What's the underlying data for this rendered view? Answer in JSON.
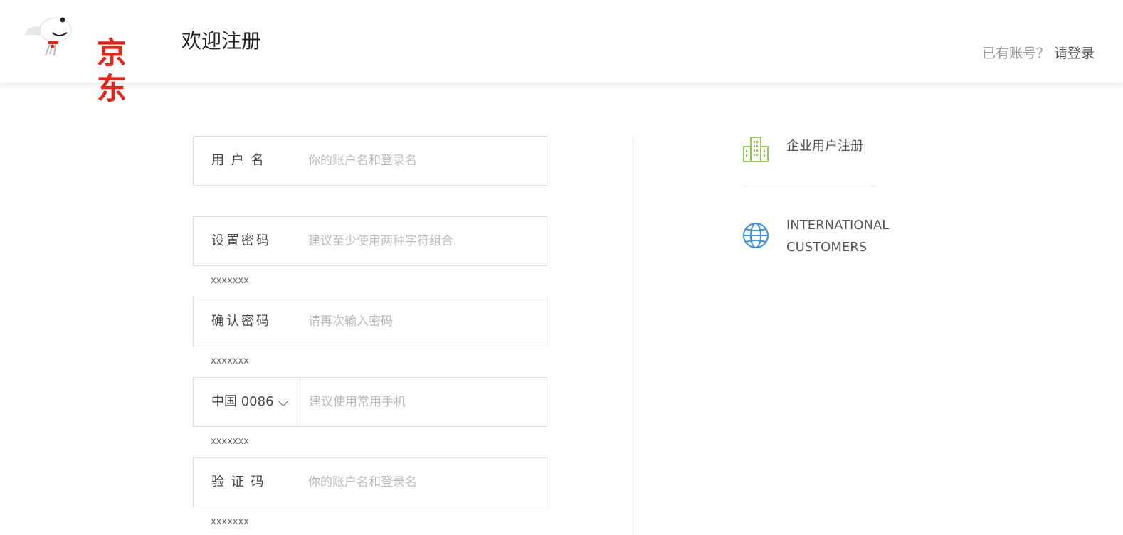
{
  "header": {
    "logo_text": "京东",
    "title": "欢迎注册",
    "have_account": "已有账号？",
    "login_link": "请登录"
  },
  "form": {
    "username": {
      "label": "用 户 名",
      "placeholder": "你的账户名和登录名"
    },
    "password": {
      "label": "设置密码",
      "placeholder": "建议至少使用两种字符组合",
      "hint": "xxxxxxx"
    },
    "confirm": {
      "label": "确认密码",
      "placeholder": "请再次输入密码",
      "hint": "xxxxxxx"
    },
    "phone": {
      "country": "中国 0086",
      "placeholder": "建议使用常用手机",
      "hint": "xxxxxxx"
    },
    "captcha": {
      "label": "验 证 码",
      "placeholder": "你的账户名和登录名",
      "hint": "xxxxxxx"
    }
  },
  "side": {
    "enterprise": {
      "label": "企业用户注册",
      "icon": "building-icon",
      "color": "#8cc152"
    },
    "international": {
      "line1": "INTERNATIONAL",
      "line2": "CUSTOMERS",
      "icon": "globe-icon",
      "color": "#3e8fd8"
    }
  },
  "colors": {
    "brand": "#e1251b",
    "border": "#dddddd",
    "placeholder": "#bbbbbb"
  }
}
